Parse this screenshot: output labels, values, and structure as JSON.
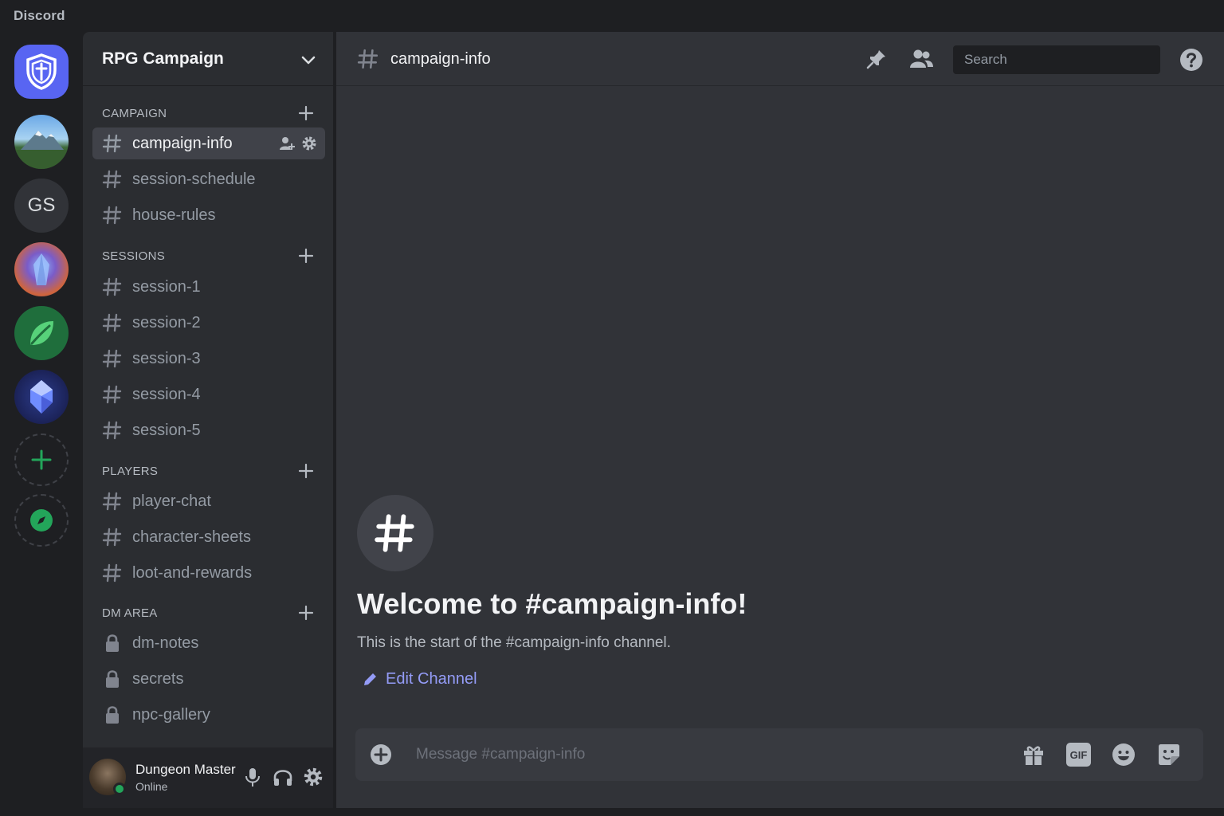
{
  "app": {
    "brand": "Discord"
  },
  "servers": {
    "gs_initials": "GS"
  },
  "server": {
    "name": "RPG Campaign"
  },
  "categories": [
    {
      "label": "CAMPAIGN"
    },
    {
      "label": "SESSIONS"
    },
    {
      "label": "PLAYERS"
    },
    {
      "label": "DM AREA"
    }
  ],
  "channels": {
    "campaign": [
      "campaign-info",
      "session-schedule",
      "house-rules"
    ],
    "sessions": [
      "session-1",
      "session-2",
      "session-3",
      "session-4",
      "session-5"
    ],
    "players": [
      "player-chat",
      "character-sheets",
      "loot-and-rewards"
    ],
    "dm_area": [
      "dm-notes",
      "secrets",
      "npc-gallery"
    ]
  },
  "user": {
    "name": "Dungeon Master",
    "status": "Online"
  },
  "topbar": {
    "channel_name": "campaign-info",
    "search_placeholder": "Search"
  },
  "welcome": {
    "title": "Welcome to #campaign-info!",
    "subtitle": "This is the start of the #campaign-info channel.",
    "edit_label": "Edit Channel"
  },
  "composer": {
    "placeholder": "Message #campaign-info",
    "gif_label": "GIF"
  },
  "colors": {
    "accent": "#5865f2",
    "link": "#949cf7",
    "online": "#23a55a",
    "green_icon": "#23a55a"
  }
}
